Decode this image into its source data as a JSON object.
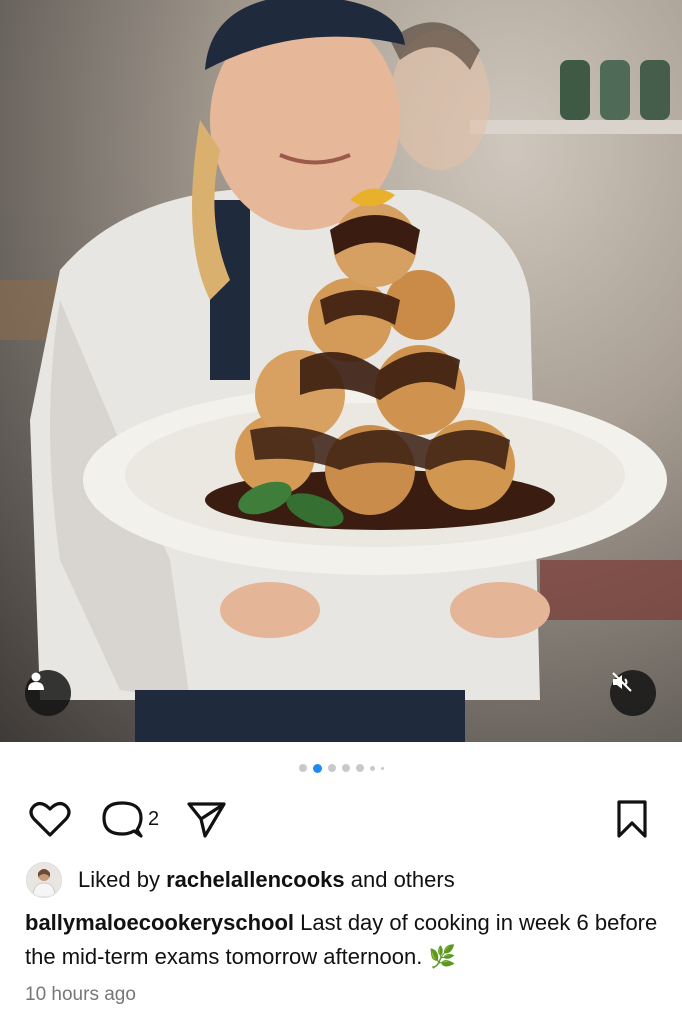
{
  "post": {
    "photo_alt": "",
    "carousel": {
      "total": 7,
      "active_index": 1
    }
  },
  "actions": {
    "like_icon": "heart-icon",
    "comment_icon": "comment-icon",
    "comment_count": "2",
    "share_icon": "send-icon",
    "save_icon": "bookmark-icon"
  },
  "likes": {
    "prefix": "Liked by",
    "user": "rachelallencooks",
    "suffix": "and others"
  },
  "caption": {
    "username": "ballymaloecookeryschool",
    "text": "Last day of cooking in week 6 before the mid-term exams tomorrow afternoon.",
    "emoji": "🌿"
  },
  "timestamp": "10 hours ago",
  "colors": {
    "accent": "#1d8cf0",
    "muted": "#777777"
  }
}
